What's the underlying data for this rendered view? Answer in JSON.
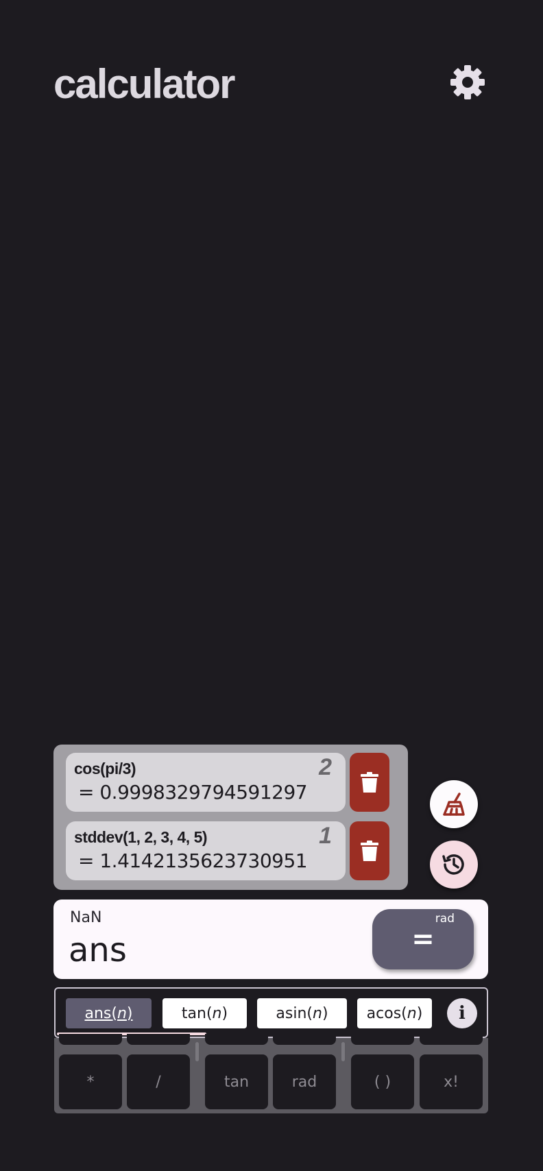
{
  "app": {
    "title": "calculator"
  },
  "history": [
    {
      "expression": "cos(pi/3)",
      "result": "= 0.9998329794591297",
      "index": "2"
    },
    {
      "expression": "stddev(1, 2, 3, 4, 5)",
      "result": "= 1.4142135623730951",
      "index": "1"
    }
  ],
  "input": {
    "preview": "NaN",
    "value": "ans",
    "equals_label": "=",
    "angle_mode": "rad"
  },
  "suggestions": [
    {
      "name": "ans",
      "arg": "n",
      "selected": true
    },
    {
      "name": "tan",
      "arg": "n",
      "selected": false
    },
    {
      "name": "asin",
      "arg": "n",
      "selected": false
    },
    {
      "name": "acos",
      "arg": "n",
      "selected": false
    }
  ],
  "keypad": {
    "keys": [
      "*",
      "/",
      "tan",
      "rad",
      "( )",
      "x!"
    ]
  },
  "colors": {
    "background": "#1d1b20",
    "delete": "#9b2e23",
    "accent": "#5f5c70",
    "history_fab": "#f6dbe2"
  },
  "icons": {
    "settings": "gear-icon",
    "delete": "trash-icon",
    "clear": "broom-icon",
    "history": "history-icon",
    "info": "info-icon"
  }
}
